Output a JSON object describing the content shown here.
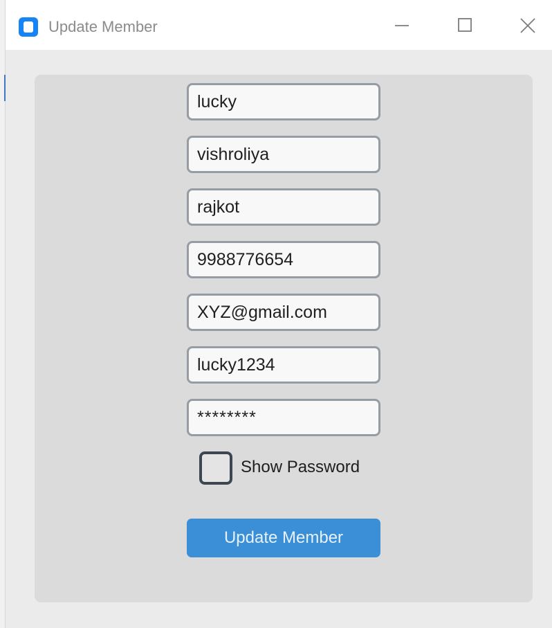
{
  "window": {
    "title": "Update Member",
    "icon": "app-window-icon",
    "controls": {
      "minimize_icon": "minimize-icon",
      "maximize_icon": "maximize-icon",
      "close_icon": "close-icon"
    }
  },
  "form": {
    "fields": {
      "first_name": "lucky",
      "last_name": "vishroliya",
      "city": "rajkot",
      "phone": "9988776654",
      "email": "XYZ@gmail.com",
      "username": "lucky1234",
      "password_masked": "********"
    },
    "show_password": {
      "label": "Show Password",
      "checked": false
    },
    "submit_label": "Update Member"
  },
  "colors": {
    "panel": "#dbdbdb",
    "field_border": "#959ca3",
    "button": "#3a8fd7",
    "button_text": "#e7f1fa",
    "app_icon": "#1684f5"
  }
}
